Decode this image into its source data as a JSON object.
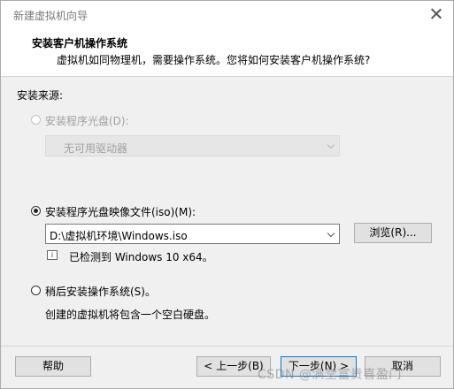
{
  "window": {
    "title": "新建虚拟机向导"
  },
  "header": {
    "title": "安装客户机操作系统",
    "subtitle": "虚拟机如同物理机，需要操作系统。您将如何安装客户机操作系统?"
  },
  "source": {
    "label": "安装来源:",
    "disc_option": {
      "label": "安装程序光盘(D):",
      "selected": false,
      "enabled": false
    },
    "disc_combo": {
      "value": "无可用驱动器",
      "enabled": false
    },
    "iso_option": {
      "label": "安装程序光盘映像文件(iso)(M):",
      "selected": true
    },
    "iso_path": {
      "value": "D:\\虚拟机环境\\Windows.iso"
    },
    "browse_label": "浏览(R)...",
    "detected_text": "已检测到 Windows 10 x64。",
    "later_option": {
      "label": "稍后安装操作系统(S)。",
      "selected": false
    },
    "later_desc": "创建的虚拟机将包含一个空白硬盘。"
  },
  "footer": {
    "help_label": "帮助",
    "back_label": "< 上一步(B)",
    "next_label": "下一步(N) >",
    "cancel_label": "取消"
  },
  "watermark": "CSDN @满堂富贵喜盈门",
  "colors": {
    "focus_border": "#0078d7",
    "disabled_text": "#a0a0a0"
  }
}
